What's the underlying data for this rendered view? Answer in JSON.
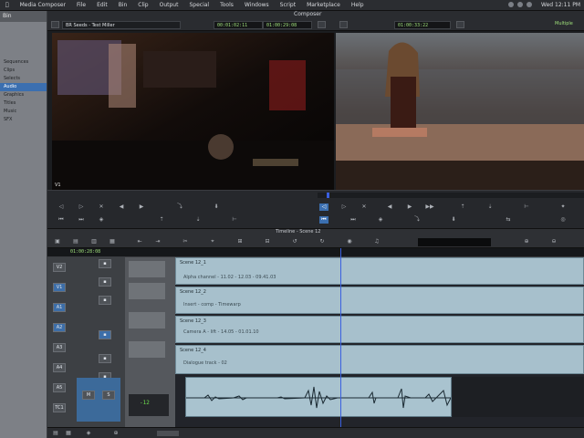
{
  "app": {
    "name": "Avid Media Composer",
    "menus": [
      "Media Composer",
      "File",
      "Edit",
      "Bin",
      "Clip",
      "Output",
      "Special",
      "Tools",
      "Windows",
      "Script",
      "Marketplace",
      "Help"
    ],
    "clock": "Wed 12:11 PM"
  },
  "bin_panel": {
    "title": "Bin",
    "items": [
      "Sequences",
      "Clips",
      "Selects",
      "Audio",
      "Graphics",
      "Titles",
      "Music",
      "SFX"
    ],
    "selected_index": 3
  },
  "composer": {
    "title": "Composer",
    "source_label": "BR Seeds - Test Miller",
    "timecodes": [
      "00:01:02:11",
      "01:00:29:08",
      "01:00:33:22"
    ],
    "right_label": "Multiple",
    "left_viewer_indicator": "V1"
  },
  "timeline": {
    "title": "Timeline - Scene 12",
    "master_timecode": "01:00:28:08",
    "tracks": [
      {
        "name": "V2",
        "enabled": false
      },
      {
        "name": "V1",
        "enabled": true
      },
      {
        "name": "A1",
        "enabled": true
      },
      {
        "name": "A2",
        "enabled": true
      },
      {
        "name": "A3",
        "enabled": false
      },
      {
        "name": "A4",
        "enabled": false
      },
      {
        "name": "A5",
        "enabled": false
      },
      {
        "name": "TC1",
        "enabled": false
      }
    ],
    "clips": [
      {
        "label": "Scene 12_1",
        "note": "Alpha channel - 11.02 - 12.03 - 09.41.03"
      },
      {
        "label": "Scene 12_2",
        "note": "Insert - comp - Timewarp"
      },
      {
        "label": "Scene 12_3",
        "note": "Camera A - lift - 14.05 - 01.01.10"
      },
      {
        "label": "Scene 12_4",
        "note": "Dialogue track - 02"
      }
    ],
    "meter_value": "-12"
  },
  "colors": {
    "accent": "#3b6fb0",
    "playhead": "#3a5fe0",
    "timecode_green": "#9fe07a",
    "clip_fill": "#a7c0cc"
  }
}
